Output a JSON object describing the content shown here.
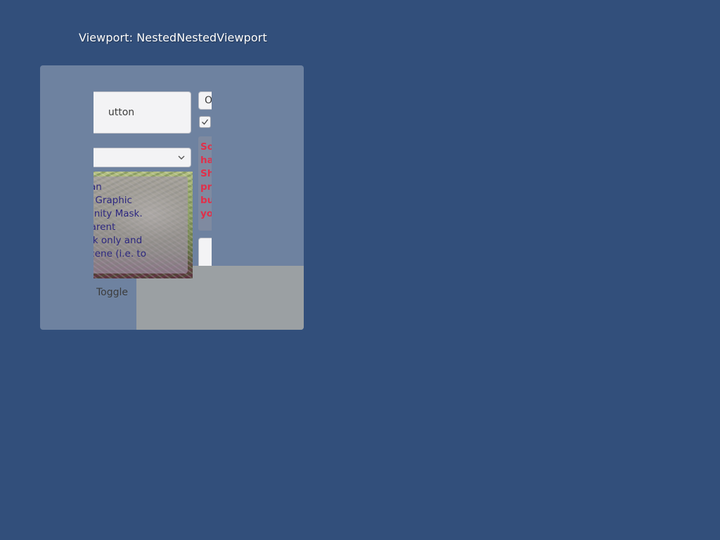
{
  "viewport": {
    "title": "Viewport: NestedNestedViewport"
  },
  "controls": {
    "button_label": "utton",
    "small_button_label": "O",
    "checkbox_checked": true,
    "toggle_label": "Toggle",
    "dropdown_value": ""
  },
  "image_panel": {
    "lines": [
      "t have an",
      "w Mask Graphic",
      "uilt-in Unity Mask.",
      "e the parent",
      "oft mask only and",
      "n the scene (i.e. to"
    ]
  },
  "red_text": {
    "lines": [
      "So",
      "ha",
      "Sh",
      "pr",
      "bu",
      "yo"
    ],
    "color": "#e0304a"
  },
  "colors": {
    "background": "#324f7b",
    "panel": "#6e82a0",
    "gray_block": "#9ba0a3",
    "image_text": "#2c2780"
  },
  "icons": {
    "dropdown": "chevron-down-icon",
    "checkbox": "checkmark-icon"
  }
}
